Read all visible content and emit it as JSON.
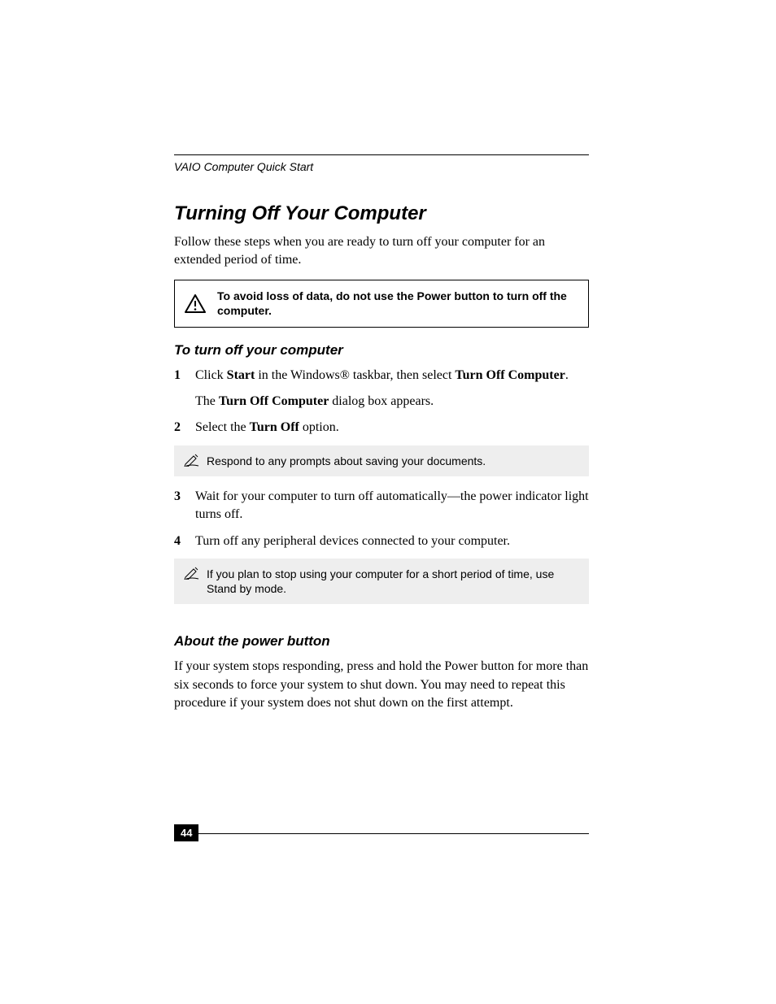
{
  "header": {
    "running": "VAIO Computer Quick Start"
  },
  "title": "Turning Off Your Computer",
  "intro": "Follow these steps when you are ready to turn off your computer for an extended period of time.",
  "warning": {
    "text": "To avoid loss of data, do not use the Power button to turn off the computer."
  },
  "section1": {
    "heading": "To turn off your computer",
    "steps": [
      {
        "num": "1",
        "line1_pre": "Click ",
        "line1_b1": "Start",
        "line1_mid": " in the Windows® taskbar, then select ",
        "line1_b2": "Turn Off Computer",
        "line1_post": ".",
        "line2_pre": "The ",
        "line2_b": "Turn Off Computer",
        "line2_post": " dialog box appears."
      },
      {
        "num": "2",
        "line1_pre": "Select the ",
        "line1_b1": "Turn Off",
        "line1_post": " option."
      }
    ],
    "note1": "Respond to any prompts about saving your documents.",
    "steps_after": [
      {
        "num": "3",
        "text": "Wait for your computer to turn off automatically—the power indicator light turns off."
      },
      {
        "num": "4",
        "text": "Turn off any peripheral devices connected to your computer."
      }
    ],
    "note2": "If you plan to stop using your computer for a short period of time, use Stand by mode."
  },
  "section2": {
    "heading": "About the power button",
    "body": "If your system stops responding, press and hold the Power button for more than six seconds to force your system to shut down. You may need to repeat this procedure if your system does not shut down on the first attempt."
  },
  "footer": {
    "page": "44"
  }
}
